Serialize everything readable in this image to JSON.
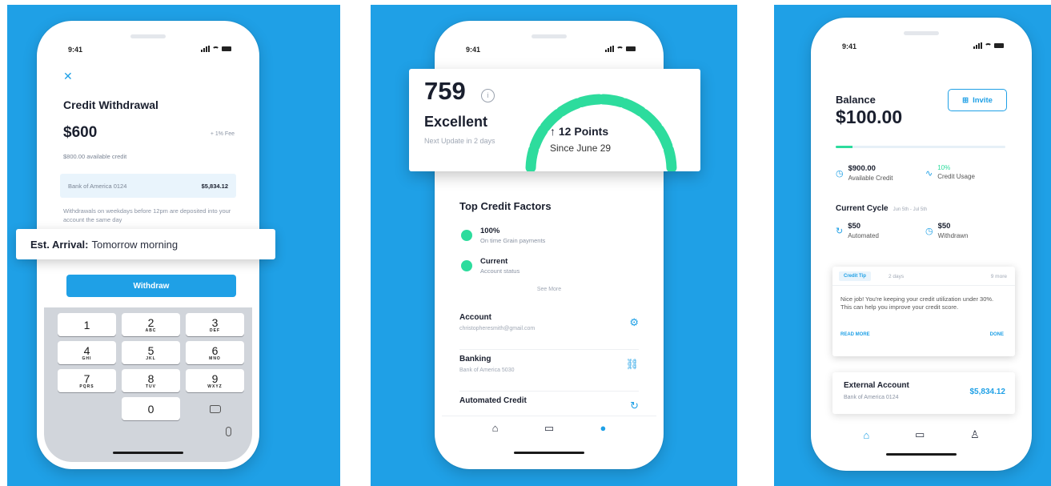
{
  "status": {
    "time": "9:41"
  },
  "screen1": {
    "close_icon": "close-icon",
    "title": "Credit Withdrawal",
    "amount": "$600",
    "fee": "+ 1% Fee",
    "available": "$800.00 available credit",
    "bank_name": "Bank of America 0124",
    "bank_balance": "$5,834.12",
    "note": "Withdrawals on weekdays before 12pm are deposited into your account the same day",
    "arrival_label": "Est. Arrival:",
    "arrival_value": "Tomorrow morning",
    "withdraw_button": "Withdraw",
    "keys": [
      {
        "num": "1",
        "letters": ""
      },
      {
        "num": "2",
        "letters": "ABC"
      },
      {
        "num": "3",
        "letters": "DEF"
      },
      {
        "num": "4",
        "letters": "GHI"
      },
      {
        "num": "5",
        "letters": "JKL"
      },
      {
        "num": "6",
        "letters": "MNO"
      },
      {
        "num": "7",
        "letters": "PQRS"
      },
      {
        "num": "8",
        "letters": "TUV"
      },
      {
        "num": "9",
        "letters": "WXYZ"
      },
      {
        "num": "0",
        "letters": ""
      }
    ]
  },
  "screen2": {
    "score": "759",
    "rating": "Excellent",
    "next_update": "Next Update in 2 days",
    "points": "↑ 12 Points",
    "since": "Since June 29",
    "gauge_fraction": 0.78,
    "gauge_color": "#2ddc9d",
    "factors_title": "Top Credit Factors",
    "factors": [
      {
        "value": "100%",
        "label": "On time Grain payments"
      },
      {
        "value": "Current",
        "label": "Account status"
      }
    ],
    "see_more": "See More",
    "rows": [
      {
        "title": "Account",
        "sub": "christopheresmith@gmail.com",
        "icon": "gear-icon"
      },
      {
        "title": "Banking",
        "sub": "Bank of America 5030",
        "icon": "link-icon"
      },
      {
        "title": "Automated Credit",
        "sub": "",
        "icon": "refresh-icon"
      }
    ],
    "tabs": [
      "home-icon",
      "card-icon",
      "profile-icon"
    ]
  },
  "screen3": {
    "balance_label": "Balance",
    "balance": "$100.00",
    "invite_button": "Invite",
    "progress": 0.1,
    "available_value": "$900.00",
    "available_label": "Available Credit",
    "usage_value": "10%",
    "usage_label": "Credit Usage",
    "cycle_label": "Current Cycle",
    "cycle_dates": "Jun 5th - Jul 5th",
    "automated_value": "$50",
    "automated_label": "Automated",
    "withdrawn_value": "$50",
    "withdrawn_label": "Withdrawn",
    "tip_tag": "Credit Tip",
    "tip_days": "2 days",
    "tip_more": "9 more",
    "tip_body": "Nice job! You're keeping your credit utilization under 30%. This can help you improve your credit score.",
    "tip_read_more": "READ MORE",
    "tip_done": "DONE",
    "ext_title": "External Account",
    "ext_sub": "Bank of America 0124",
    "ext_balance": "$5,834.12"
  },
  "colors": {
    "brand": "#1fa0e6",
    "accent_green": "#2ddc9d",
    "text": "#1a1f2e"
  }
}
